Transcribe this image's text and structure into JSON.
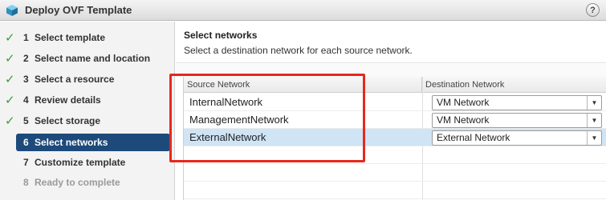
{
  "window": {
    "title": "Deploy OVF Template",
    "help_label": "?"
  },
  "colors": {
    "accent": "#1d4a7a",
    "check": "#3a9c3a",
    "highlight": "#e7281c",
    "selected_row": "#cfe4f5"
  },
  "steps": [
    {
      "num": "1",
      "label": "Select template",
      "state": "done"
    },
    {
      "num": "2",
      "label": "Select name and location",
      "state": "done"
    },
    {
      "num": "3",
      "label": "Select a resource",
      "state": "done"
    },
    {
      "num": "4",
      "label": "Review details",
      "state": "done"
    },
    {
      "num": "5",
      "label": "Select storage",
      "state": "done"
    },
    {
      "num": "6",
      "label": "Select networks",
      "state": "active"
    },
    {
      "num": "7",
      "label": "Customize template",
      "state": "pending"
    },
    {
      "num": "8",
      "label": "Ready to complete",
      "state": "disabled"
    }
  ],
  "content": {
    "title": "Select networks",
    "subtitle": "Select a destination network for each source network."
  },
  "grid": {
    "columns": {
      "source": "Source Network",
      "destination": "Destination Network"
    },
    "rows": [
      {
        "source": "InternalNetwork",
        "destination": "VM Network",
        "selected": false
      },
      {
        "source": "ManagementNetwork",
        "destination": "VM Network",
        "selected": false
      },
      {
        "source": "ExternalNetwork",
        "destination": "External Network",
        "selected": true
      }
    ]
  }
}
